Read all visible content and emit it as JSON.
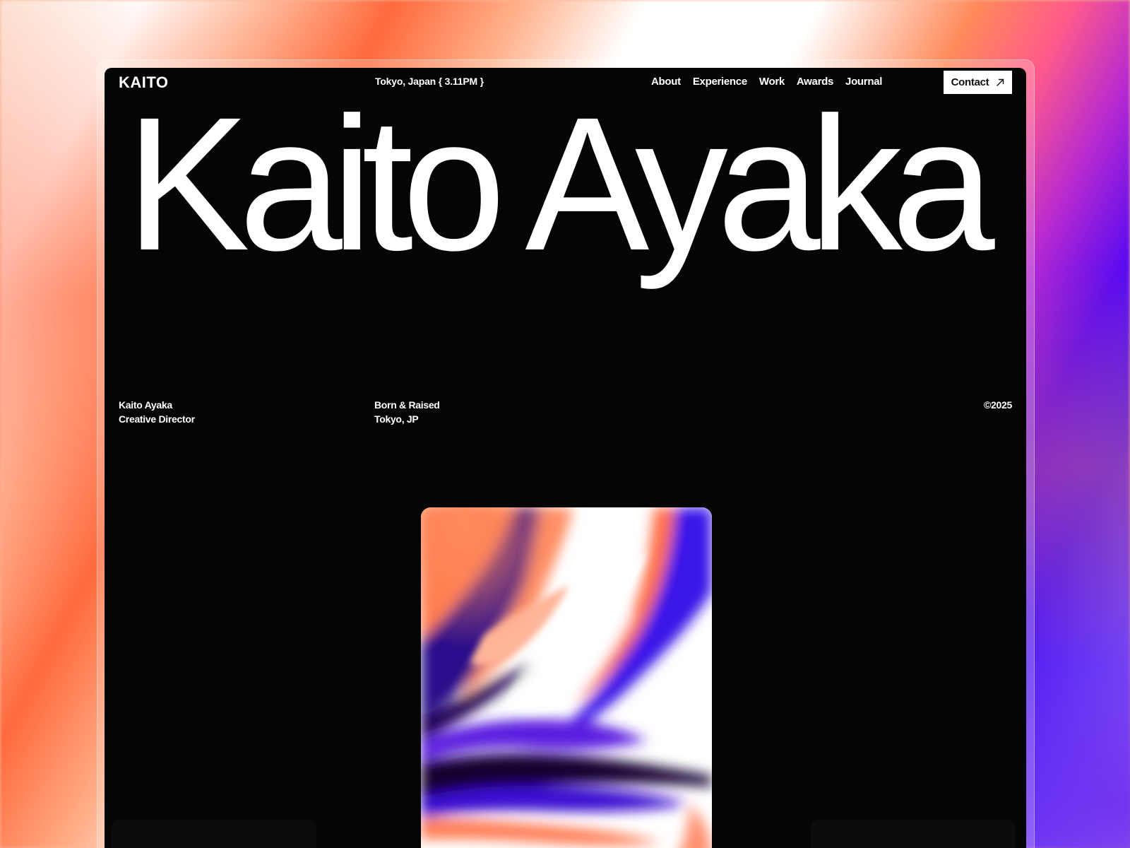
{
  "header": {
    "logo": "KAITO",
    "location": "Tokyo, Japan { 3.11PM }",
    "nav": [
      "About",
      "Experience",
      "Work",
      "Awards",
      "Journal"
    ],
    "contact_label": "Contact"
  },
  "hero": {
    "title": "Kaito Ayaka"
  },
  "info": {
    "name": "Kaito Ayaka",
    "role": "Creative Director",
    "origin_label": "Born & Raised",
    "origin_place": "Tokyo, JP",
    "copyright": "©2025"
  },
  "icons": {
    "contact": "arrow-up-right-icon"
  },
  "colors": {
    "window_bg": "#050505",
    "text": "#ffffff",
    "accent_orange": "#ff6a3d",
    "accent_violet": "#4a1cf5"
  }
}
